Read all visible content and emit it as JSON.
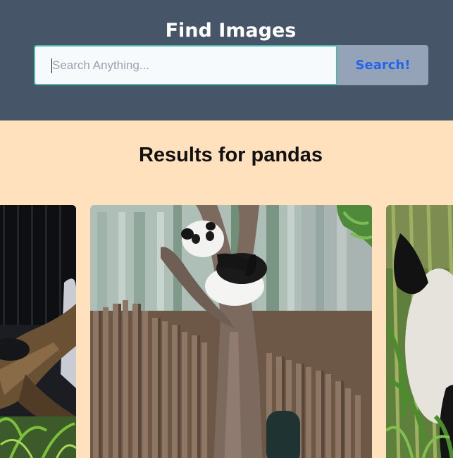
{
  "header": {
    "title": "Find Images",
    "search": {
      "placeholder": "Search Anything...",
      "value": ""
    },
    "search_button_label": "Search!"
  },
  "results": {
    "heading": "Results for pandas",
    "images": [
      {
        "subject": "panda on log (partially visible)"
      },
      {
        "subject": "panda resting in tree"
      },
      {
        "subject": "panda in bamboo (partially visible)"
      }
    ]
  }
}
